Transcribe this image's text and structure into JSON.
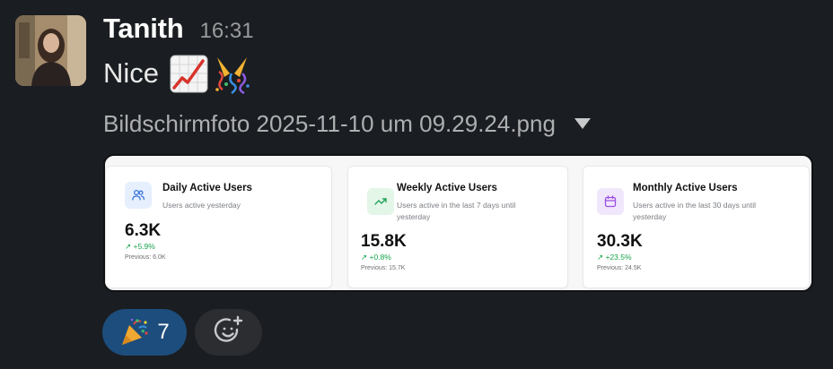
{
  "message": {
    "author": "Tanith",
    "time": "16:31",
    "text": "Nice",
    "emojis": [
      "chart-increasing-icon",
      "party-popper-icon"
    ]
  },
  "attachment": {
    "file_name": "Bildschirmfoto 2025-11-10 um 09.29.24.png",
    "toggle_icon": "caret-down-icon"
  },
  "preview": {
    "cards": [
      {
        "icon": "users-icon",
        "title": "Daily Active Users",
        "description": "Users active yesterday",
        "value": "6.3K",
        "change": "↗ +5.9%",
        "previous": "Previous: 6.0K"
      },
      {
        "icon": "trending-up-icon",
        "title": "Weekly Active Users",
        "description": "Users active in the last 7 days until yesterday",
        "value": "15.8K",
        "change": "↗ +0.8%",
        "previous": "Previous: 15.7K"
      },
      {
        "icon": "calendar-icon",
        "title": "Monthly Active Users",
        "description": "Users active in the last 30 days until yesterday",
        "value": "30.3K",
        "change": "↗ +23.5%",
        "previous": "Previous: 24.5K"
      }
    ]
  },
  "reactions": [
    {
      "emoji": "party-popper-icon",
      "count": "7"
    }
  ],
  "add_reaction_icon": "add-reaction-icon",
  "colors": {
    "background": "#1a1d21",
    "reaction_active": "#1d4d7c",
    "positive_change": "#16a34a"
  }
}
